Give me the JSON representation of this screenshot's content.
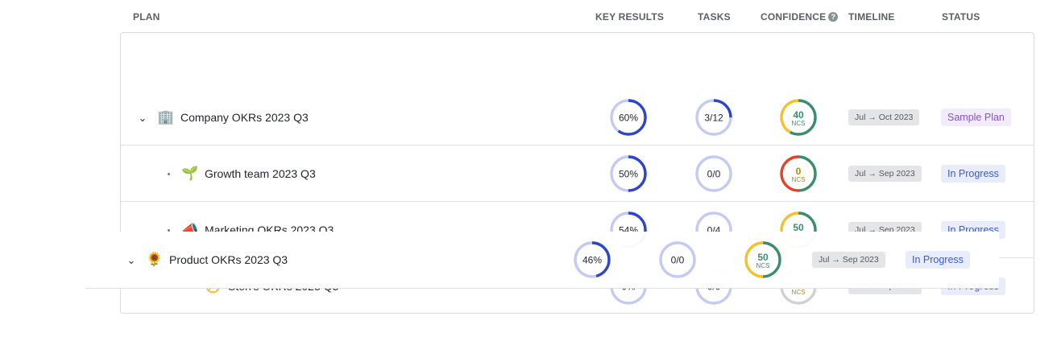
{
  "headers": {
    "plan": "PLAN",
    "key_results": "KEY RESULTS",
    "tasks": "TASKS",
    "confidence": "CONFIDENCE",
    "timeline": "TIMELINE",
    "status": "STATUS",
    "confidence_help_icon": "?"
  },
  "rows": [
    {
      "name": "Company OKRs 2023 Q3",
      "icon": "🏢",
      "icon_name": "office-building-icon",
      "key_results": "60%",
      "kr_progress": 0.6,
      "tasks": "3/12",
      "tasks_progress": 0.25,
      "confidence": "40",
      "confidence_unit": "NCS",
      "timeline": "Jul → Oct 2023",
      "status": "Sample Plan"
    },
    {
      "name": "Growth team 2023 Q3",
      "icon": "🌱",
      "icon_name": "seedling-icon",
      "key_results": "50%",
      "kr_progress": 0.5,
      "tasks": "0/0",
      "tasks_progress": 0,
      "confidence": "0",
      "confidence_unit": "NCS",
      "timeline": "Jul → Sep 2023",
      "status": "In Progress"
    },
    {
      "name": "Marketing OKRs 2023 Q3",
      "icon": "📣",
      "icon_name": "megaphone-icon",
      "key_results": "54%",
      "kr_progress": 0.54,
      "tasks": "0/4",
      "tasks_progress": 0,
      "confidence": "50",
      "confidence_unit": "NCS",
      "timeline": "Jul → Sep 2023",
      "status": "In Progress"
    },
    {
      "name": "Sten's OKRs 2023 Q3",
      "icon": "🧭",
      "icon_name": "compass-icon",
      "key_results": "0%",
      "kr_progress": 0,
      "tasks": "0/0",
      "tasks_progress": 0,
      "confidence": "",
      "confidence_unit": "NCS",
      "timeline": "Jul → Sep 2023",
      "status": "In Progress"
    }
  ],
  "dragging_row": {
    "name": "Product OKRs 2023 Q3",
    "icon": "🌻",
    "icon_name": "sunflower-icon",
    "key_results": "46%",
    "kr_progress": 0.46,
    "tasks": "0/0",
    "tasks_progress": 0,
    "confidence": "50",
    "confidence_unit": "NCS",
    "timeline": "Jul → Sep 2023",
    "status": "In Progress"
  },
  "colors": {
    "progress_fill": "#2f47c7",
    "progress_track": "#c4cbf2",
    "conf_green": "#3c8c6e",
    "conf_yellow": "#f2c12e",
    "conf_red": "#e0452b",
    "conf_gray": "#d0d1d3"
  }
}
